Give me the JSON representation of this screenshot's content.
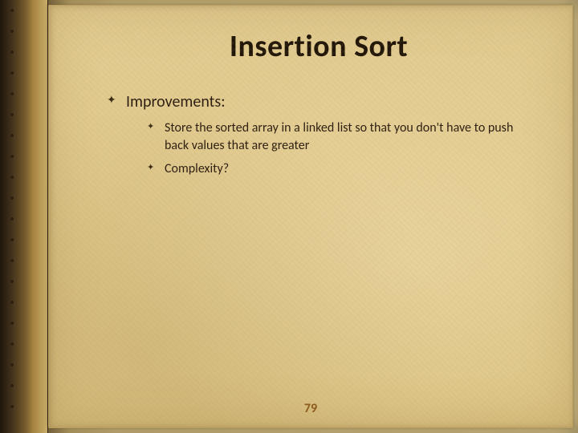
{
  "title": "Insertion Sort",
  "bullets": {
    "heading": "Improvements:",
    "items": [
      "Store the sorted array in a linked list so that you don't have to push back values that are greater",
      "Complexity?"
    ]
  },
  "page_number": "79"
}
